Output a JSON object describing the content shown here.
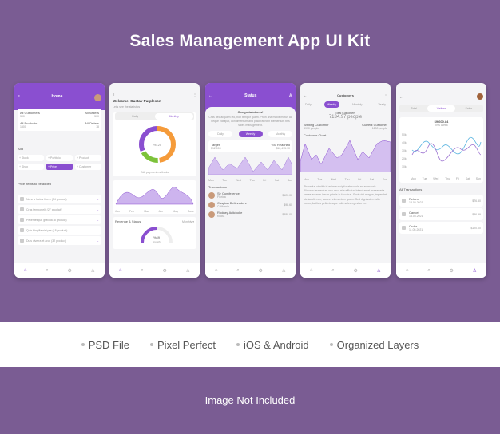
{
  "title": "Sales Management App UI Kit",
  "features": [
    "PSD File",
    "Pixel Perfect",
    "iOS & Android",
    "Organized Layers"
  ],
  "footer": "Image Not Included",
  "home": {
    "title": "Home",
    "stats": [
      {
        "label": "All Customers",
        "value": "300"
      },
      {
        "label": "All Sellers",
        "value": "500"
      },
      {
        "label": "All Products",
        "value": "1500"
      },
      {
        "label": "All Orders",
        "value": "18"
      }
    ],
    "add_label": "Add",
    "add_buttons": [
      "Stock",
      "Portfolio",
      "Product",
      "Shop",
      "Price",
      "Customer"
    ],
    "list_title": "Price items to be added",
    "items": [
      "Nunc a luctus libero (54 product)",
      "Cras tempor elit (27 product)",
      "Pellentesque gravida (8 product)",
      "Quis fringilla nisi pre (18 product)",
      "Duis viverra et arcu (32 product)"
    ]
  },
  "stats": {
    "welcome": "Welcome, Gustav Purpleson",
    "sub": "Let's see the statistics",
    "tabs": [
      "Daily",
      "Monthly"
    ],
    "donut_label": "%125",
    "edit": "Edit payment methods",
    "months": [
      "Jan",
      "Feb",
      "Mar",
      "Apr",
      "May",
      "June"
    ],
    "rev_title": "Revenue & Status",
    "rev_period": "Monthly",
    "growth": "%49",
    "growth_label": "growth"
  },
  "status": {
    "title": "Status",
    "congrats": "Congratulations!",
    "text": "Cras nec aliquam leo, non tempor quam. Proin ana mollis metus ac neque volutpat, condimentum and placerat nibh elementum this sales management.",
    "tabs": [
      "Daily",
      "Weekly",
      "Monthly"
    ],
    "target_label": "Target",
    "target": "$12,000",
    "reached_label": "You Reached",
    "reached": "$12,495.90",
    "days": [
      "Mon",
      "Tue",
      "Wed",
      "Thu",
      "Fri",
      "Sat",
      "Sun"
    ],
    "tx_title": "Transactions",
    "tx": [
      {
        "name": "Sir Cumference",
        "loc": "Florida",
        "amt": "$120.00"
      },
      {
        "name": "Caspian Bellevedere",
        "loc": "California",
        "amt": "$98.60"
      },
      {
        "name": "Rodney Artichoke",
        "loc": "Kuota",
        "amt": "$380.00"
      }
    ]
  },
  "customers": {
    "title": "Customers",
    "tabs": [
      "Daily",
      "Weekly",
      "Monthly",
      "Yearly"
    ],
    "total_label": "Total Customers",
    "total": "7134.97 people",
    "waiting_label": "Waiting Customer",
    "waiting": "4990 people",
    "current_label": "Current Customer",
    "current": "1200 people",
    "chart_title": "Customer Chart",
    "days": [
      "Mon",
      "Tue",
      "Wed",
      "Thu",
      "Fri",
      "Sat",
      "Sun"
    ],
    "text": "Phasellus ut nibh id enim suscipit malesuada an ac mauris. Aliquam fermentum nec arcu at a efficitur. Interdum et malesuada fames ac ante ipsum primis in faucibus. Proin dui magna, imperdiet ide iaculis non, laoreet elementum quam. Sed dignissim nislin purus, facilisis pellentesque odio sales egestas eu."
  },
  "visitors": {
    "tabs": [
      "Total",
      "Visitors",
      "Sales"
    ],
    "amount": "$9,600.84",
    "period": "This Week",
    "yticks": [
      "50k",
      "40k",
      "30k",
      "20k",
      "10k"
    ],
    "days": [
      "Mon",
      "Tue",
      "Wed",
      "Thu",
      "Fri",
      "Sat",
      "Sun"
    ],
    "tx_title": "All Transactions",
    "tx": [
      {
        "name": "Return",
        "date": "18.05.2021",
        "amt": "$76.50"
      },
      {
        "name": "Cancel",
        "date": "13.05.2021",
        "amt": "$36.99"
      },
      {
        "name": "Order",
        "date": "11.05.2021",
        "amt": "$120.00"
      }
    ]
  }
}
